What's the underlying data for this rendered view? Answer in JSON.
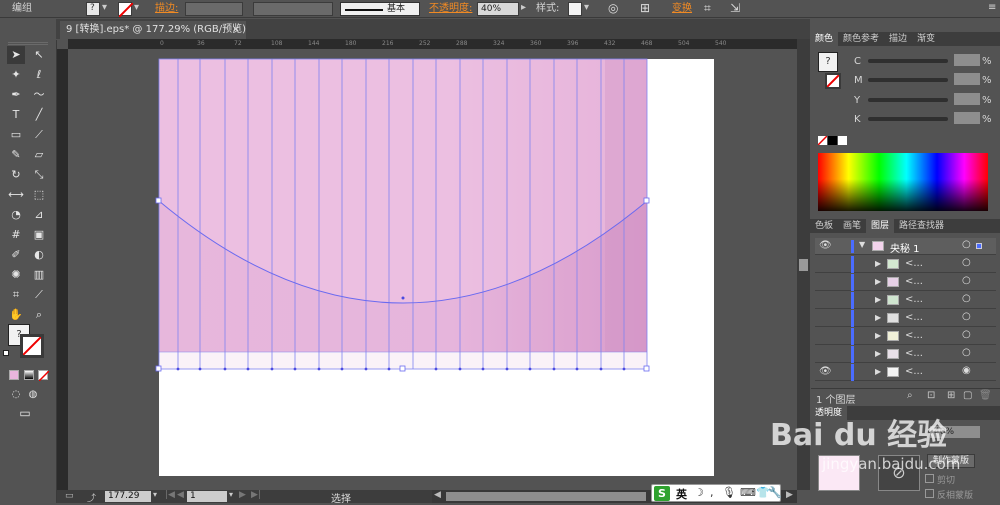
{
  "control_bar": {
    "group_label": "编组",
    "stroke_label": "描边:",
    "stroke_profile": "基本",
    "opacity_label": "不透明度:",
    "opacity_value": "40%",
    "style_label": "样式:",
    "transform_label": "变换"
  },
  "document_tab": {
    "title": "9 [转换].eps* @ 177.29% (RGB/预览)",
    "close": "×"
  },
  "ruler_ticks": [
    "0",
    "36",
    "72",
    "108",
    "144",
    "180",
    "216",
    "252",
    "288",
    "324",
    "360",
    "396",
    "432",
    "468",
    "504",
    "540"
  ],
  "color_panel": {
    "tabs": [
      "颜色",
      "颜色参考",
      "描边",
      "渐变"
    ],
    "channels": [
      {
        "label": "C",
        "value": "%"
      },
      {
        "label": "M",
        "value": "%"
      },
      {
        "label": "Y",
        "value": "%"
      },
      {
        "label": "K",
        "value": "%"
      }
    ]
  },
  "layers_panel": {
    "tabs": [
      "色板",
      "画笔",
      "图层",
      "路径查找器"
    ],
    "top_layer": "央秘 1",
    "sublayer_label": "<...",
    "footer_count": "1 个图层"
  },
  "bottom_panel": {
    "tab": "透明度",
    "opacity_value": "40%",
    "make_mask": "制作蒙版",
    "clip": "剪切",
    "invert_mask": "反相蒙版"
  },
  "status_bar": {
    "zoom": "177.29",
    "page": "1",
    "tool_status": "选择"
  },
  "ime_bar": {
    "lang": "英"
  },
  "watermark": {
    "brand": "Bai du 经验",
    "url": "jingyan.baidu.com"
  },
  "colors": {
    "ui_bg": "#535353",
    "accent_orange": "#f08a24",
    "selection_blue": "#6a6aff",
    "art_pink": "#e3b0d8"
  }
}
